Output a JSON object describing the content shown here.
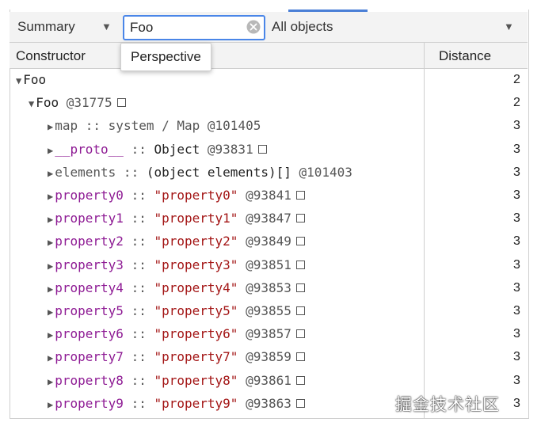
{
  "toolbar": {
    "view_select": "Summary",
    "filter_value": "Foo",
    "objects_select": "All objects"
  },
  "tooltip": "Perspective",
  "columns": {
    "constructor": "Constructor",
    "distance": "Distance"
  },
  "rows": [
    {
      "indent": 0,
      "expanded": true,
      "parts": [
        {
          "t": "Foo",
          "c": "plain"
        }
      ],
      "box": false,
      "distance": "2"
    },
    {
      "indent": 1,
      "expanded": true,
      "parts": [
        {
          "t": "Foo",
          "c": "plain"
        },
        {
          "t": " @31775",
          "c": "grey"
        }
      ],
      "box": true,
      "distance": "2"
    },
    {
      "indent": 2,
      "expanded": false,
      "parts": [
        {
          "t": "map",
          "c": "grey"
        },
        {
          "t": " :: ",
          "c": "grey"
        },
        {
          "t": "system / Map",
          "c": "grey"
        },
        {
          "t": " @101405",
          "c": "grey"
        }
      ],
      "box": false,
      "distance": "3"
    },
    {
      "indent": 2,
      "expanded": false,
      "parts": [
        {
          "t": "__proto__",
          "c": "purple"
        },
        {
          "t": " :: ",
          "c": "grey"
        },
        {
          "t": "Object",
          "c": "obj"
        },
        {
          "t": " @93831",
          "c": "grey"
        }
      ],
      "box": true,
      "distance": "3"
    },
    {
      "indent": 2,
      "expanded": false,
      "parts": [
        {
          "t": "elements",
          "c": "grey"
        },
        {
          "t": " :: ",
          "c": "grey"
        },
        {
          "t": "(object elements)[]",
          "c": "obj"
        },
        {
          "t": " @101403",
          "c": "grey"
        }
      ],
      "box": false,
      "distance": "3"
    },
    {
      "indent": 2,
      "expanded": false,
      "parts": [
        {
          "t": "property0",
          "c": "purple"
        },
        {
          "t": " :: ",
          "c": "grey"
        },
        {
          "t": "\"property0\"",
          "c": "str"
        },
        {
          "t": " @93841",
          "c": "grey"
        }
      ],
      "box": true,
      "distance": "3"
    },
    {
      "indent": 2,
      "expanded": false,
      "parts": [
        {
          "t": "property1",
          "c": "purple"
        },
        {
          "t": " :: ",
          "c": "grey"
        },
        {
          "t": "\"property1\"",
          "c": "str"
        },
        {
          "t": " @93847",
          "c": "grey"
        }
      ],
      "box": true,
      "distance": "3"
    },
    {
      "indent": 2,
      "expanded": false,
      "parts": [
        {
          "t": "property2",
          "c": "purple"
        },
        {
          "t": " :: ",
          "c": "grey"
        },
        {
          "t": "\"property2\"",
          "c": "str"
        },
        {
          "t": " @93849",
          "c": "grey"
        }
      ],
      "box": true,
      "distance": "3"
    },
    {
      "indent": 2,
      "expanded": false,
      "parts": [
        {
          "t": "property3",
          "c": "purple"
        },
        {
          "t": " :: ",
          "c": "grey"
        },
        {
          "t": "\"property3\"",
          "c": "str"
        },
        {
          "t": " @93851",
          "c": "grey"
        }
      ],
      "box": true,
      "distance": "3"
    },
    {
      "indent": 2,
      "expanded": false,
      "parts": [
        {
          "t": "property4",
          "c": "purple"
        },
        {
          "t": " :: ",
          "c": "grey"
        },
        {
          "t": "\"property4\"",
          "c": "str"
        },
        {
          "t": " @93853",
          "c": "grey"
        }
      ],
      "box": true,
      "distance": "3"
    },
    {
      "indent": 2,
      "expanded": false,
      "parts": [
        {
          "t": "property5",
          "c": "purple"
        },
        {
          "t": " :: ",
          "c": "grey"
        },
        {
          "t": "\"property5\"",
          "c": "str"
        },
        {
          "t": " @93855",
          "c": "grey"
        }
      ],
      "box": true,
      "distance": "3"
    },
    {
      "indent": 2,
      "expanded": false,
      "parts": [
        {
          "t": "property6",
          "c": "purple"
        },
        {
          "t": " :: ",
          "c": "grey"
        },
        {
          "t": "\"property6\"",
          "c": "str"
        },
        {
          "t": " @93857",
          "c": "grey"
        }
      ],
      "box": true,
      "distance": "3"
    },
    {
      "indent": 2,
      "expanded": false,
      "parts": [
        {
          "t": "property7",
          "c": "purple"
        },
        {
          "t": " :: ",
          "c": "grey"
        },
        {
          "t": "\"property7\"",
          "c": "str"
        },
        {
          "t": " @93859",
          "c": "grey"
        }
      ],
      "box": true,
      "distance": "3"
    },
    {
      "indent": 2,
      "expanded": false,
      "parts": [
        {
          "t": "property8",
          "c": "purple"
        },
        {
          "t": " :: ",
          "c": "grey"
        },
        {
          "t": "\"property8\"",
          "c": "str"
        },
        {
          "t": " @93861",
          "c": "grey"
        }
      ],
      "box": true,
      "distance": "3"
    },
    {
      "indent": 2,
      "expanded": false,
      "parts": [
        {
          "t": "property9",
          "c": "purple"
        },
        {
          "t": " :: ",
          "c": "grey"
        },
        {
          "t": "\"property9\"",
          "c": "str"
        },
        {
          "t": " @93863",
          "c": "grey"
        }
      ],
      "box": true,
      "distance": "3"
    }
  ],
  "watermark": "掘金技术社区",
  "colors": {
    "accent": "#4a86e8",
    "property_name": "#8e1b94",
    "string_value": "#a31515"
  }
}
